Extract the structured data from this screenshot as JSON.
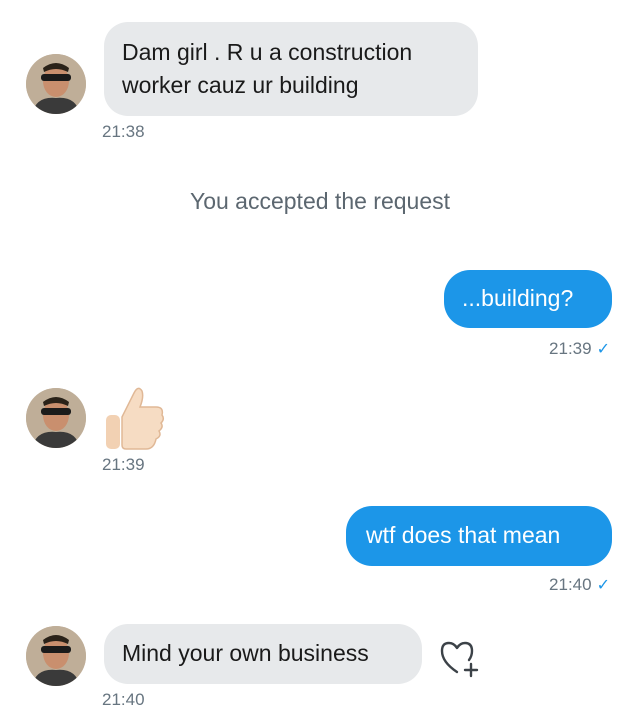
{
  "messages": [
    {
      "text": "Dam girl . R u a construction\nworker cauz ur building",
      "time": "21:38"
    },
    {
      "text": "...building?",
      "time": "21:39"
    },
    {
      "emoji": "thumbs-up",
      "time": "21:39"
    },
    {
      "text": "wtf does that mean",
      "time": "21:40"
    },
    {
      "text": "Mind your own business",
      "time": "21:40"
    }
  ],
  "system_message": "You accepted the request",
  "read_receipt": "✓",
  "colors": {
    "incoming": "#e7e9eb",
    "outgoing": "#1c96e8",
    "timestamp": "#677580"
  },
  "icons": {
    "reaction": "add-reaction-heart-icon",
    "avatar": "avatar-photo",
    "emoji": "thumbs-up-emoji"
  }
}
